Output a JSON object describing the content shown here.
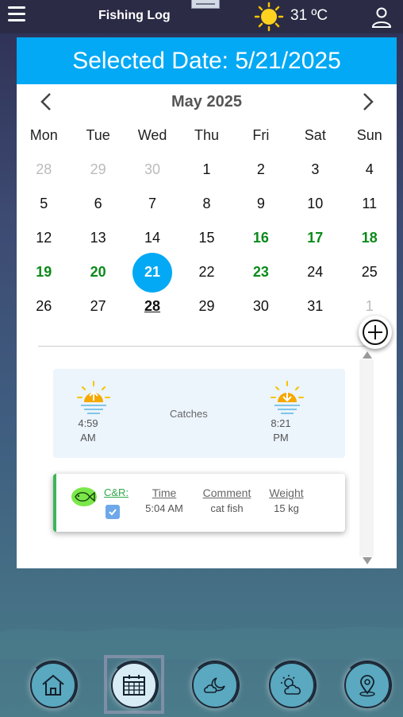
{
  "app": {
    "title": "Fishing Log",
    "temperature": "31 ºC",
    "weather_icon": "sun-icon",
    "accent_color": "#03a9f4"
  },
  "selected_date": {
    "label": "Selected Date: 5/21/2025"
  },
  "calendar": {
    "month_label": "May 2025",
    "weekdays": [
      "Mon",
      "Tue",
      "Wed",
      "Thu",
      "Fri",
      "Sat",
      "Sun"
    ],
    "weeks": [
      [
        {
          "d": "28",
          "s": "muted"
        },
        {
          "d": "29",
          "s": "muted"
        },
        {
          "d": "30",
          "s": "muted"
        },
        {
          "d": "1",
          "s": ""
        },
        {
          "d": "2",
          "s": ""
        },
        {
          "d": "3",
          "s": ""
        },
        {
          "d": "4",
          "s": ""
        }
      ],
      [
        {
          "d": "5",
          "s": ""
        },
        {
          "d": "6",
          "s": ""
        },
        {
          "d": "7",
          "s": ""
        },
        {
          "d": "8",
          "s": ""
        },
        {
          "d": "9",
          "s": ""
        },
        {
          "d": "10",
          "s": ""
        },
        {
          "d": "11",
          "s": ""
        }
      ],
      [
        {
          "d": "12",
          "s": ""
        },
        {
          "d": "13",
          "s": ""
        },
        {
          "d": "14",
          "s": ""
        },
        {
          "d": "15",
          "s": ""
        },
        {
          "d": "16",
          "s": "green"
        },
        {
          "d": "17",
          "s": "green"
        },
        {
          "d": "18",
          "s": "green"
        }
      ],
      [
        {
          "d": "19",
          "s": "green"
        },
        {
          "d": "20",
          "s": "green"
        },
        {
          "d": "21",
          "s": "selected"
        },
        {
          "d": "22",
          "s": ""
        },
        {
          "d": "23",
          "s": "green"
        },
        {
          "d": "24",
          "s": ""
        },
        {
          "d": "25",
          "s": ""
        }
      ],
      [
        {
          "d": "26",
          "s": ""
        },
        {
          "d": "27",
          "s": ""
        },
        {
          "d": "28",
          "s": "today"
        },
        {
          "d": "29",
          "s": ""
        },
        {
          "d": "30",
          "s": ""
        },
        {
          "d": "31",
          "s": ""
        },
        {
          "d": "1",
          "s": "muted"
        }
      ]
    ]
  },
  "sun": {
    "sunrise_time": "4:59",
    "sunrise_period": "AM",
    "sunset_time": "8:21",
    "sunset_period": "PM",
    "catches_label": "Catches"
  },
  "catch": {
    "cr_label": "C&R:",
    "cr_checked": true,
    "time_header": "Time",
    "time_value": "5:04 AM",
    "comment_header": "Comment",
    "comment_value": "cat fish",
    "weight_header": "Weight",
    "weight_value": "15 kg"
  },
  "bottom_nav": [
    {
      "icon": "home-icon"
    },
    {
      "icon": "calendar-icon",
      "active": true
    },
    {
      "icon": "cloud-moon-icon"
    },
    {
      "icon": "cloud-sun-icon"
    },
    {
      "icon": "map-pin-icon"
    }
  ]
}
